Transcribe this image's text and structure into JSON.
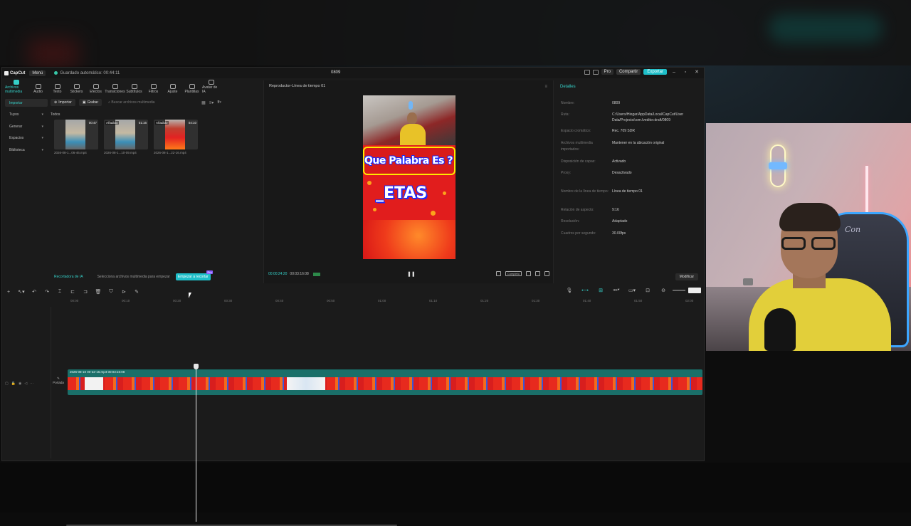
{
  "app": {
    "logo": "CapCut",
    "menu_label": "Menú",
    "autosave": "Guardado automático: 00:44:11",
    "project_title": "0809",
    "pro_label": "Pro",
    "share_label": "Compartir",
    "export_label": "Exportar",
    "accent_color": "#1fbfc9"
  },
  "toolbar": [
    {
      "label": "Archivos multimedia",
      "icon": "media-icon"
    },
    {
      "label": "Audio",
      "icon": "audio-icon"
    },
    {
      "label": "Texto",
      "icon": "text-icon"
    },
    {
      "label": "Stickers",
      "icon": "sticker-icon"
    },
    {
      "label": "Efectos",
      "icon": "effects-icon"
    },
    {
      "label": "Transiciones",
      "icon": "transitions-icon"
    },
    {
      "label": "Subtítulos",
      "icon": "subtitles-icon"
    },
    {
      "label": "Filtros",
      "icon": "filters-icon"
    },
    {
      "label": "Ajuste",
      "icon": "adjust-icon"
    },
    {
      "label": "Plantillas",
      "icon": "templates-icon"
    },
    {
      "label": "Avatar de IA",
      "icon": "avatar-icon"
    }
  ],
  "leftnav": [
    {
      "label": "Importar"
    },
    {
      "label": "Tuyos"
    },
    {
      "label": "Generar"
    },
    {
      "label": "Espacios"
    },
    {
      "label": "Biblioteca"
    }
  ],
  "media": {
    "import_label": "Importar",
    "record_label": "Grabar",
    "search_placeholder": "Buscar archivos multimedia",
    "section_label": "Todos",
    "items": [
      {
        "name": "2026-08-1...06-46.mp4",
        "duration": "00:47",
        "badge": ""
      },
      {
        "name": "2026-08-1...10-09.mp4",
        "duration": "01:16",
        "badge": "Añadido"
      },
      {
        "name": "2026-08-1...22-16.mp4",
        "duration": "04:10",
        "badge": "Añadido"
      }
    ],
    "ai_cutter": "Recortadora de IA",
    "hint": "Selecciona archivos multimedia para empezar",
    "start_button": "Empezar a recortar",
    "start_badge": "Pro"
  },
  "player": {
    "title": "Reproductor-Línea de tiempo 01",
    "video_line1": "Que Palabra Es ?",
    "video_line2": "_ETAS",
    "timecode_current": "00:00:24:20",
    "timecode_total": "00:03:16:08",
    "ratio_chip": "Completo"
  },
  "details": {
    "title": "Detalles",
    "rows": [
      {
        "k": "Nombre:",
        "v": "0809"
      },
      {
        "k": "Ruta:",
        "v": "C:/Users/Hiogar/AppData/Local/CapCut/User Data/Projects/com.lveditor.draft/0809"
      },
      {
        "k": "Espacio cromático:",
        "v": "Rec. 709 SDR"
      },
      {
        "k": "Archivos multimedia importados:",
        "v": "Mantener en la ubicación original"
      },
      {
        "k": "Disposición de capas:",
        "v": "Activado"
      },
      {
        "k": "Proxy:",
        "v": "Desactivado"
      },
      {
        "k": "Nombre de la línea de tiempo:",
        "v": "Línea de tiempo 01"
      },
      {
        "k": "Relación de aspecto:",
        "v": "9:16"
      },
      {
        "k": "Resolución:",
        "v": "Adaptado"
      },
      {
        "k": "Cuadros por segundo:",
        "v": "30.00fps"
      }
    ],
    "modify_button": "Modificar"
  },
  "timeline": {
    "ticks": [
      "00:00",
      "00:10",
      "00:20",
      "00:30",
      "00:40",
      "00:50",
      "01:00",
      "01:10",
      "01:20",
      "01:30",
      "01:40",
      "01:50",
      "02:00"
    ],
    "cover_label": "Portada",
    "clip_label": "2026-08-10 00-22-16.mp4   00:03:16:08"
  }
}
